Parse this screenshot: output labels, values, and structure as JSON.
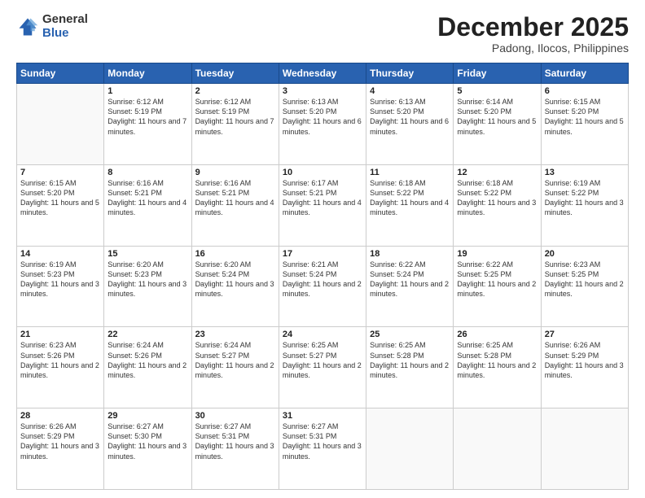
{
  "logo": {
    "general": "General",
    "blue": "Blue"
  },
  "header": {
    "month": "December 2025",
    "location": "Padong, Ilocos, Philippines"
  },
  "weekdays": [
    "Sunday",
    "Monday",
    "Tuesday",
    "Wednesday",
    "Thursday",
    "Friday",
    "Saturday"
  ],
  "weeks": [
    [
      {
        "day": "",
        "empty": true
      },
      {
        "day": "1",
        "sunrise": "6:12 AM",
        "sunset": "5:19 PM",
        "daylight": "11 hours and 7 minutes."
      },
      {
        "day": "2",
        "sunrise": "6:12 AM",
        "sunset": "5:19 PM",
        "daylight": "11 hours and 7 minutes."
      },
      {
        "day": "3",
        "sunrise": "6:13 AM",
        "sunset": "5:20 PM",
        "daylight": "11 hours and 6 minutes."
      },
      {
        "day": "4",
        "sunrise": "6:13 AM",
        "sunset": "5:20 PM",
        "daylight": "11 hours and 6 minutes."
      },
      {
        "day": "5",
        "sunrise": "6:14 AM",
        "sunset": "5:20 PM",
        "daylight": "11 hours and 5 minutes."
      },
      {
        "day": "6",
        "sunrise": "6:15 AM",
        "sunset": "5:20 PM",
        "daylight": "11 hours and 5 minutes."
      }
    ],
    [
      {
        "day": "7",
        "sunrise": "6:15 AM",
        "sunset": "5:20 PM",
        "daylight": "11 hours and 5 minutes."
      },
      {
        "day": "8",
        "sunrise": "6:16 AM",
        "sunset": "5:21 PM",
        "daylight": "11 hours and 4 minutes."
      },
      {
        "day": "9",
        "sunrise": "6:16 AM",
        "sunset": "5:21 PM",
        "daylight": "11 hours and 4 minutes."
      },
      {
        "day": "10",
        "sunrise": "6:17 AM",
        "sunset": "5:21 PM",
        "daylight": "11 hours and 4 minutes."
      },
      {
        "day": "11",
        "sunrise": "6:18 AM",
        "sunset": "5:22 PM",
        "daylight": "11 hours and 4 minutes."
      },
      {
        "day": "12",
        "sunrise": "6:18 AM",
        "sunset": "5:22 PM",
        "daylight": "11 hours and 3 minutes."
      },
      {
        "day": "13",
        "sunrise": "6:19 AM",
        "sunset": "5:22 PM",
        "daylight": "11 hours and 3 minutes."
      }
    ],
    [
      {
        "day": "14",
        "sunrise": "6:19 AM",
        "sunset": "5:23 PM",
        "daylight": "11 hours and 3 minutes."
      },
      {
        "day": "15",
        "sunrise": "6:20 AM",
        "sunset": "5:23 PM",
        "daylight": "11 hours and 3 minutes."
      },
      {
        "day": "16",
        "sunrise": "6:20 AM",
        "sunset": "5:24 PM",
        "daylight": "11 hours and 3 minutes."
      },
      {
        "day": "17",
        "sunrise": "6:21 AM",
        "sunset": "5:24 PM",
        "daylight": "11 hours and 2 minutes."
      },
      {
        "day": "18",
        "sunrise": "6:22 AM",
        "sunset": "5:24 PM",
        "daylight": "11 hours and 2 minutes."
      },
      {
        "day": "19",
        "sunrise": "6:22 AM",
        "sunset": "5:25 PM",
        "daylight": "11 hours and 2 minutes."
      },
      {
        "day": "20",
        "sunrise": "6:23 AM",
        "sunset": "5:25 PM",
        "daylight": "11 hours and 2 minutes."
      }
    ],
    [
      {
        "day": "21",
        "sunrise": "6:23 AM",
        "sunset": "5:26 PM",
        "daylight": "11 hours and 2 minutes."
      },
      {
        "day": "22",
        "sunrise": "6:24 AM",
        "sunset": "5:26 PM",
        "daylight": "11 hours and 2 minutes."
      },
      {
        "day": "23",
        "sunrise": "6:24 AM",
        "sunset": "5:27 PM",
        "daylight": "11 hours and 2 minutes."
      },
      {
        "day": "24",
        "sunrise": "6:25 AM",
        "sunset": "5:27 PM",
        "daylight": "11 hours and 2 minutes."
      },
      {
        "day": "25",
        "sunrise": "6:25 AM",
        "sunset": "5:28 PM",
        "daylight": "11 hours and 2 minutes."
      },
      {
        "day": "26",
        "sunrise": "6:25 AM",
        "sunset": "5:28 PM",
        "daylight": "11 hours and 2 minutes."
      },
      {
        "day": "27",
        "sunrise": "6:26 AM",
        "sunset": "5:29 PM",
        "daylight": "11 hours and 3 minutes."
      }
    ],
    [
      {
        "day": "28",
        "sunrise": "6:26 AM",
        "sunset": "5:29 PM",
        "daylight": "11 hours and 3 minutes."
      },
      {
        "day": "29",
        "sunrise": "6:27 AM",
        "sunset": "5:30 PM",
        "daylight": "11 hours and 3 minutes."
      },
      {
        "day": "30",
        "sunrise": "6:27 AM",
        "sunset": "5:31 PM",
        "daylight": "11 hours and 3 minutes."
      },
      {
        "day": "31",
        "sunrise": "6:27 AM",
        "sunset": "5:31 PM",
        "daylight": "11 hours and 3 minutes."
      },
      {
        "day": "",
        "empty": true
      },
      {
        "day": "",
        "empty": true
      },
      {
        "day": "",
        "empty": true
      }
    ]
  ],
  "labels": {
    "sunrise": "Sunrise:",
    "sunset": "Sunset:",
    "daylight": "Daylight:"
  }
}
